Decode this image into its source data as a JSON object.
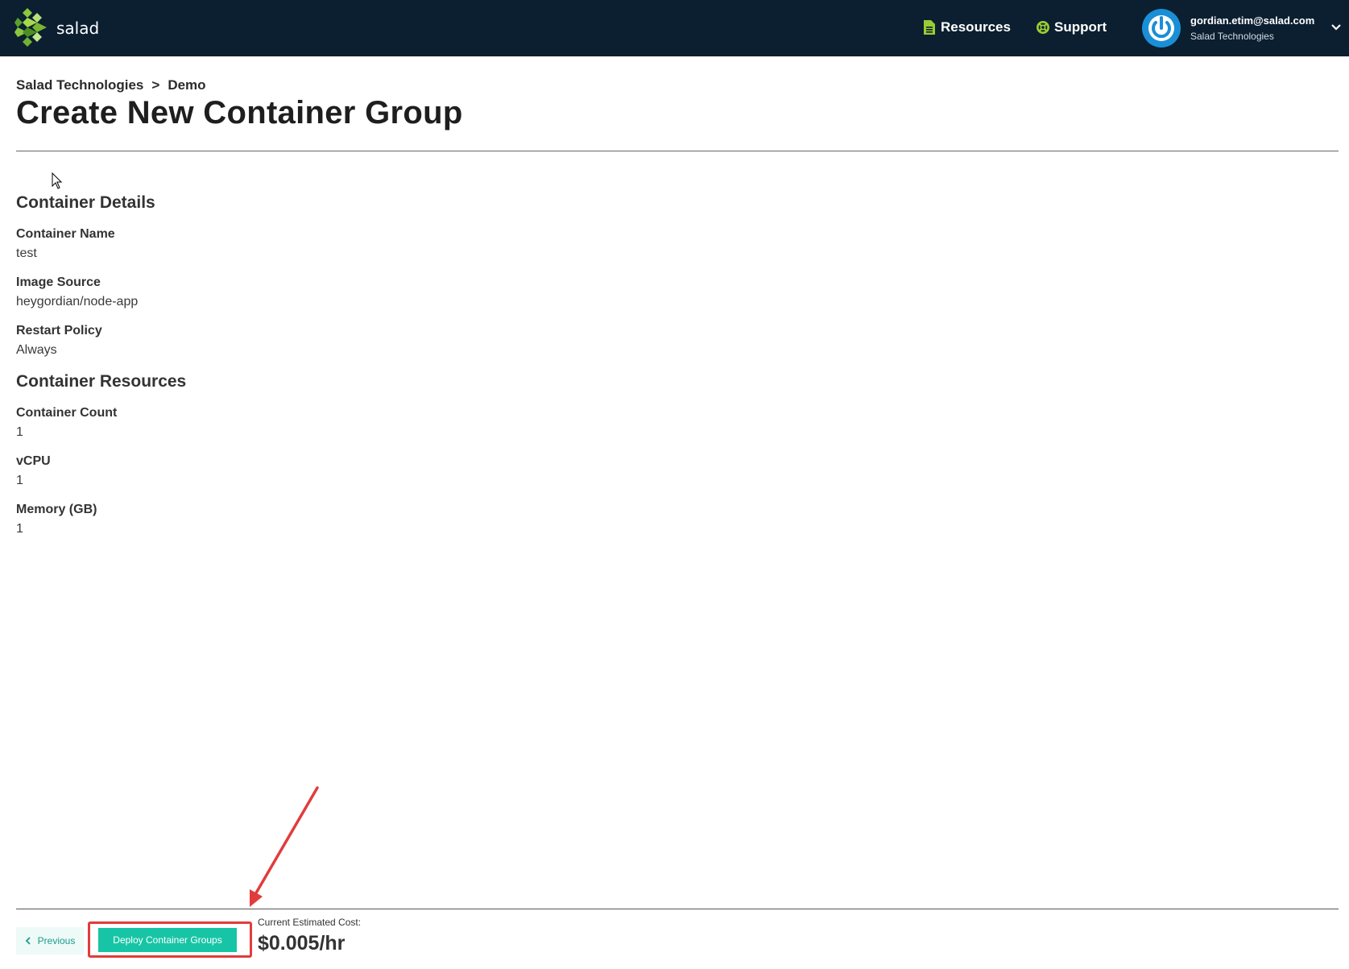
{
  "header": {
    "logo_text": "salad",
    "nav": [
      {
        "label": "Resources",
        "icon": "document-icon",
        "color": "#9acd32"
      },
      {
        "label": "Support",
        "icon": "lifebuoy-icon",
        "color": "#9acd32"
      }
    ],
    "user": {
      "email": "gordian.etim@salad.com",
      "org": "Salad Technologies"
    }
  },
  "breadcrumb": {
    "org": "Salad Technologies",
    "separator": ">",
    "project": "Demo"
  },
  "page_title": "Create New Container Group",
  "container_details": {
    "title": "Container Details",
    "fields": [
      {
        "label": "Container Name",
        "value": "test"
      },
      {
        "label": "Image Source",
        "value": "heygordian/node-app"
      },
      {
        "label": "Restart Policy",
        "value": "Always"
      }
    ]
  },
  "container_resources": {
    "title": "Container Resources",
    "fields": [
      {
        "label": "Container Count",
        "value": "1"
      },
      {
        "label": "vCPU",
        "value": "1"
      },
      {
        "label": "Memory (GB)",
        "value": "1"
      }
    ]
  },
  "footer": {
    "previous_label": "Previous",
    "deploy_label": "Deploy Container Groups",
    "cost_label": "Current Estimated Cost:",
    "cost_value": "$0.005/hr"
  },
  "colors": {
    "topbar": "#0b1f31",
    "accent": "#17c5a6",
    "highlight": "#e13c3c",
    "brand_green": "#9acd32"
  }
}
